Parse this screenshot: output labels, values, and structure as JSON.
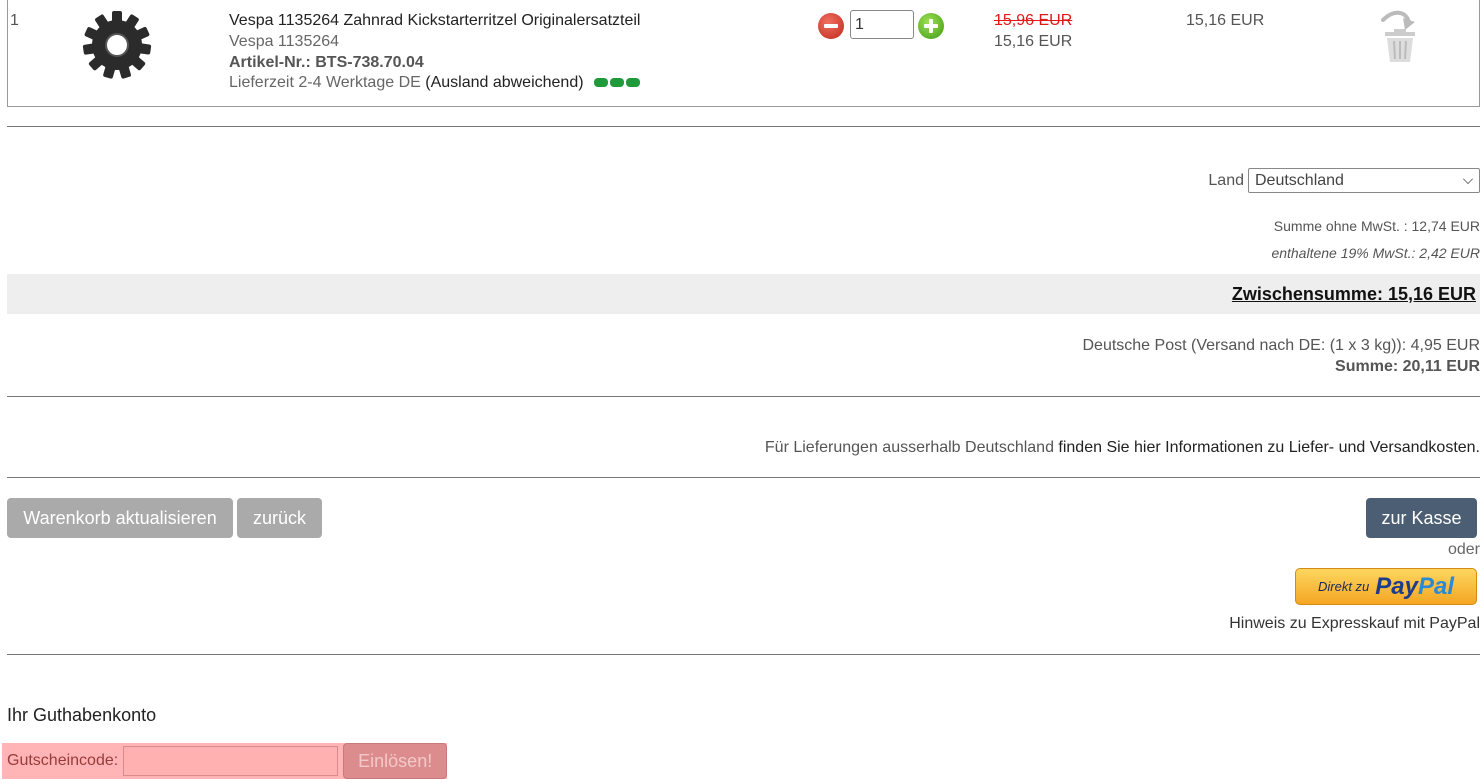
{
  "cart": {
    "item": {
      "position": "1",
      "title": "Vespa 1135264 Zahnrad Kickstarterritzel Originalersatzteil",
      "subtitle": "Vespa 1135264",
      "article_label": "Artikel-Nr.: ",
      "article_number": "BTS-738.70.04",
      "delivery_text": "Lieferzeit 2-4 Werktage DE ",
      "delivery_abroad": "(Ausland abweichend)",
      "quantity": "1",
      "price_old": "15,96 EUR",
      "price_new": "15,16 EUR",
      "price_total": "15,16 EUR",
      "image_icon": "gear-icon",
      "delete_icon": "trash-icon",
      "availability_color": "#1f9a3a"
    }
  },
  "summary": {
    "land_label": "Land",
    "land_value": "Deutschland",
    "net_sum": "Summe ohne MwSt. : 12,74 EUR",
    "tax": "enthaltene 19% MwSt.: 2,42 EUR",
    "subtotal": "Zwischensumme: 15,16 EUR",
    "shipping": "Deutsche Post (Versand nach DE: (1 x 3 kg)): 4,95 EUR",
    "total": "Summe: 20,11 EUR"
  },
  "delivery_info": {
    "prefix": "Für Lieferungen ausserhalb Deutschland ",
    "link": "finden Sie hier Informationen zu Liefer- und Versandkosten."
  },
  "actions": {
    "update_cart": "Warenkorb aktualisieren",
    "back": "zurück",
    "checkout": "zur Kasse",
    "or": "oder",
    "paypal_prefix": "Direkt zu",
    "paypal_logo_pay": "Pay",
    "paypal_logo_pal": "Pal",
    "paypal_note": "Hinweis zu Expresskauf mit PayPal",
    "checkout_color": "#4c5e73"
  },
  "credit": {
    "title": "Ihr Guthabenkonto",
    "coupon_label": "Gutscheincode:",
    "coupon_value": "",
    "redeem": "Einlösen!"
  }
}
